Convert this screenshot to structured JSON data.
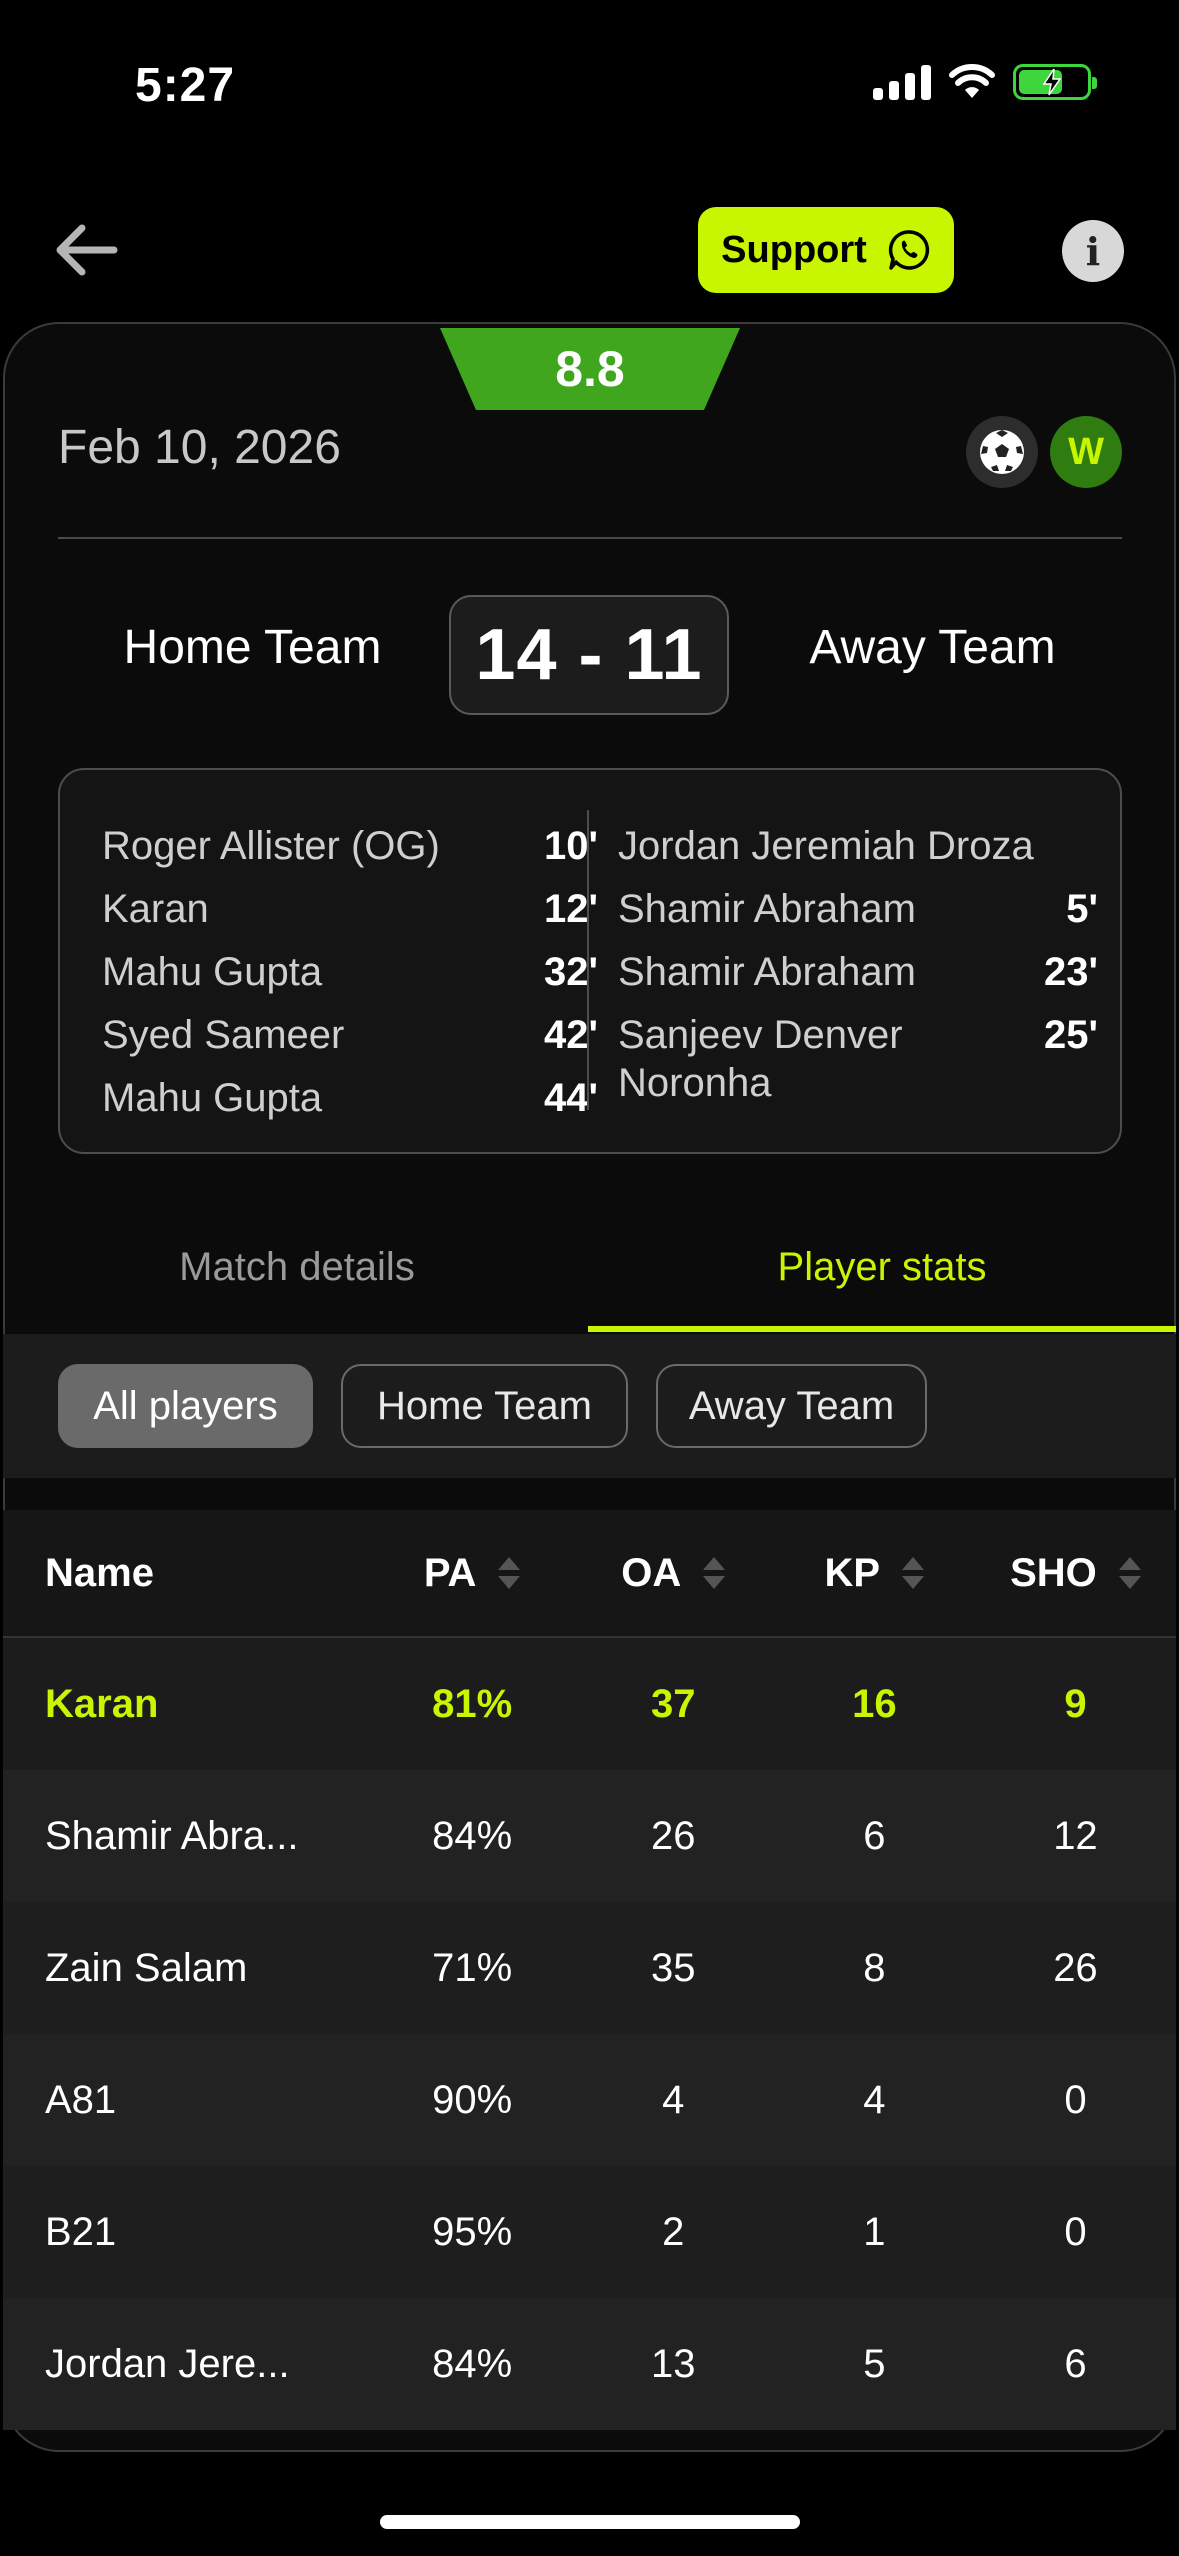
{
  "status_bar": {
    "time": "5:27"
  },
  "header": {
    "support_label": "Support"
  },
  "match": {
    "rating": "8.8",
    "date": "Feb 10, 2026",
    "result": "W",
    "home_team": "Home Team",
    "away_team": "Away Team",
    "score": "14 - 11"
  },
  "scorers": {
    "home": [
      {
        "name": "Roger Allister (OG)",
        "minute": "10'"
      },
      {
        "name": "Karan",
        "minute": "12'"
      },
      {
        "name": "Mahu Gupta",
        "minute": "32'"
      },
      {
        "name": "Syed Sameer",
        "minute": "42'"
      },
      {
        "name": "Mahu Gupta",
        "minute": "44'"
      }
    ],
    "away": [
      {
        "name": "Jordan Jeremiah Droza",
        "minute": ""
      },
      {
        "name": "Shamir Abraham",
        "minute": "5'"
      },
      {
        "name": "Shamir Abraham",
        "minute": "23'"
      },
      {
        "name": "Sanjeev Denver Noronha",
        "minute": "25'"
      }
    ]
  },
  "tabs": {
    "match_details": "Match details",
    "player_stats": "Player stats"
  },
  "filters": {
    "all": "All players",
    "home": "Home Team",
    "away": "Away Team"
  },
  "table": {
    "headers": {
      "name": "Name",
      "pa": "PA",
      "oa": "OA",
      "kp": "KP",
      "sho": "SHO"
    },
    "rows": [
      {
        "name": "Karan",
        "pa": "81%",
        "oa": "37",
        "kp": "16",
        "sho": "9"
      },
      {
        "name": "Shamir Abra...",
        "pa": "84%",
        "oa": "26",
        "kp": "6",
        "sho": "12"
      },
      {
        "name": "Zain Salam",
        "pa": "71%",
        "oa": "35",
        "kp": "8",
        "sho": "26"
      },
      {
        "name": "A81",
        "pa": "90%",
        "oa": "4",
        "kp": "4",
        "sho": "0"
      },
      {
        "name": "B21",
        "pa": "95%",
        "oa": "2",
        "kp": "1",
        "sho": "0"
      },
      {
        "name": "Jordan Jere...",
        "pa": "84%",
        "oa": "13",
        "kp": "5",
        "sho": "6"
      }
    ]
  },
  "colors": {
    "accent": "#c8f500",
    "rating_green": "#3fa61e",
    "win_badge": "#2f7c10"
  }
}
